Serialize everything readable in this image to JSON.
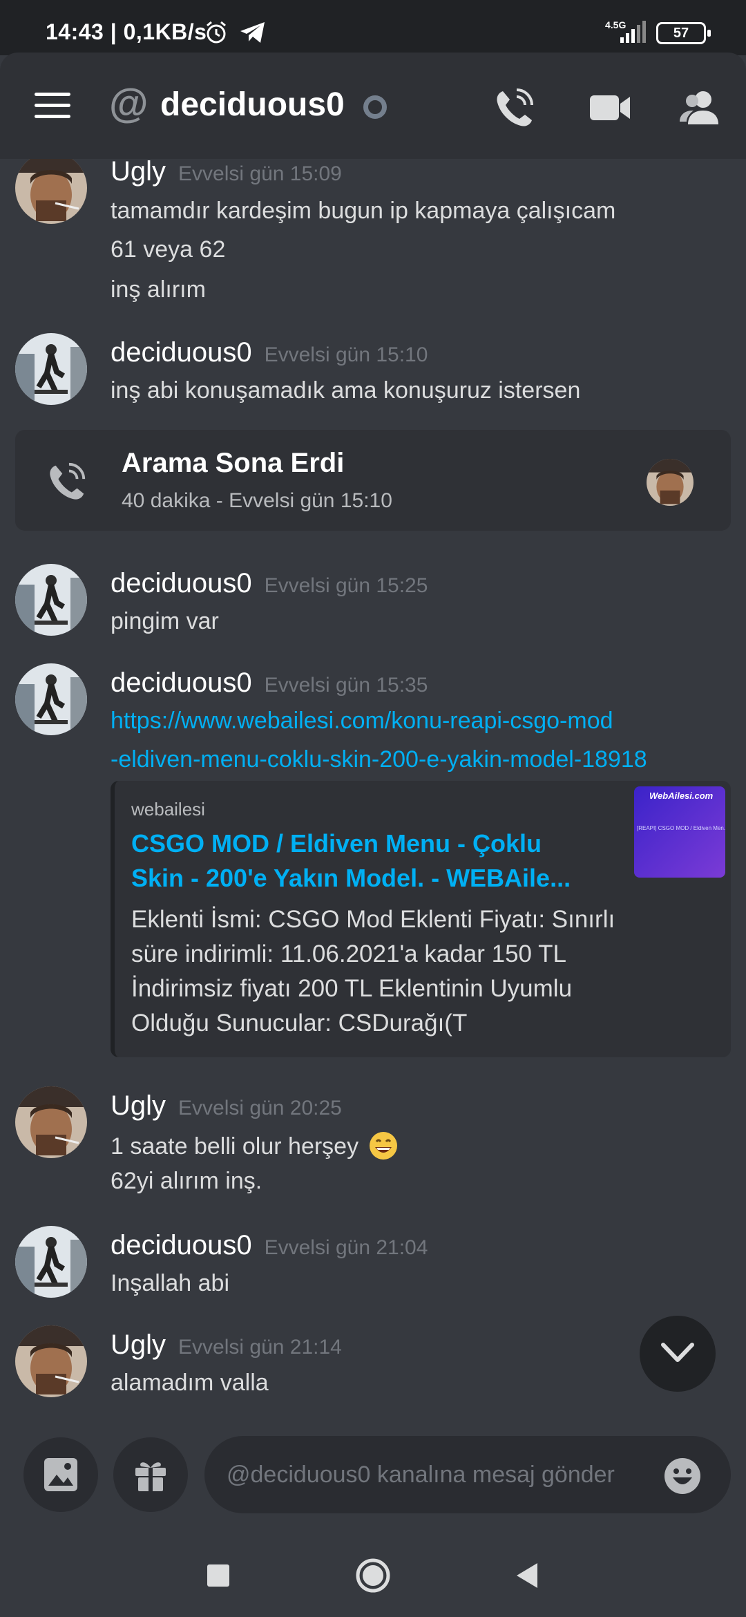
{
  "status_bar": {
    "time": "14:43",
    "speed": "| 0,1KB/s",
    "network": "4.5G",
    "battery": "57"
  },
  "header": {
    "channel_name": "deciduous0",
    "icons": [
      "menu-icon",
      "at-icon",
      "call-icon",
      "video-icon",
      "members-icon"
    ]
  },
  "messages": [
    {
      "author": "Ugly",
      "timestamp": "Evvelsi gün 15:09",
      "lines": [
        "tamamdır kardeşim bugun ip kapmaya çalışıcam",
        "61 veya 62",
        "inş alırım"
      ]
    },
    {
      "author": "deciduous0",
      "timestamp": "Evvelsi gün 15:10",
      "lines": [
        "inş abi konuşamadık ama konuşuruz istersen"
      ]
    },
    {
      "author": "deciduous0",
      "timestamp": "Evvelsi gün 15:25",
      "lines": [
        "pingim var"
      ]
    },
    {
      "author": "deciduous0",
      "timestamp": "Evvelsi gün 15:35",
      "lines": [
        "https://www.webailesi.com/konu-reapi-csgo-mod",
        "-eldiven-menu-coklu-skin-200-e-yakin-model-18918"
      ]
    },
    {
      "author": "Ugly",
      "timestamp": "Evvelsi gün 20:25",
      "lines": [
        "1 saate belli olur herşey",
        "62yi alırım inş."
      ]
    },
    {
      "author": "deciduous0",
      "timestamp": "Evvelsi gün 21:04",
      "lines": [
        "Inşallah abi"
      ]
    },
    {
      "author": "Ugly",
      "timestamp": "Evvelsi gün 21:14",
      "lines": [
        "alamadım valla"
      ]
    }
  ],
  "call_card": {
    "title": "Arama Sona Erdi",
    "subtitle": "40 dakika - Evvelsi gün 15:10"
  },
  "embed": {
    "provider": "webailesi",
    "title": "CSGO MOD / Eldiven Menu - Çoklu Skin - 200'e Yakın Model. - WEBAile...",
    "description": "Eklenti İsmi: CSGO Mod Eklenti Fiyatı: Sınırlı süre indirimli: 11.06.2021'a kadar 150 TL İndirimsiz fiyatı 200 TL Eklentinin Uyumlu Olduğu Sunucular: CSDurağı(T",
    "thumb_logo": "WebAilesi.com",
    "thumb_caption": "[REAPI] CSGO MOD / Eldiven Men..."
  },
  "composer": {
    "placeholder": "@deciduous0 kanalına mesaj gönder"
  },
  "colors": {
    "background": "#36393f",
    "header": "#2f3136",
    "link": "#00b0f4",
    "timestamp": "#72767d"
  }
}
